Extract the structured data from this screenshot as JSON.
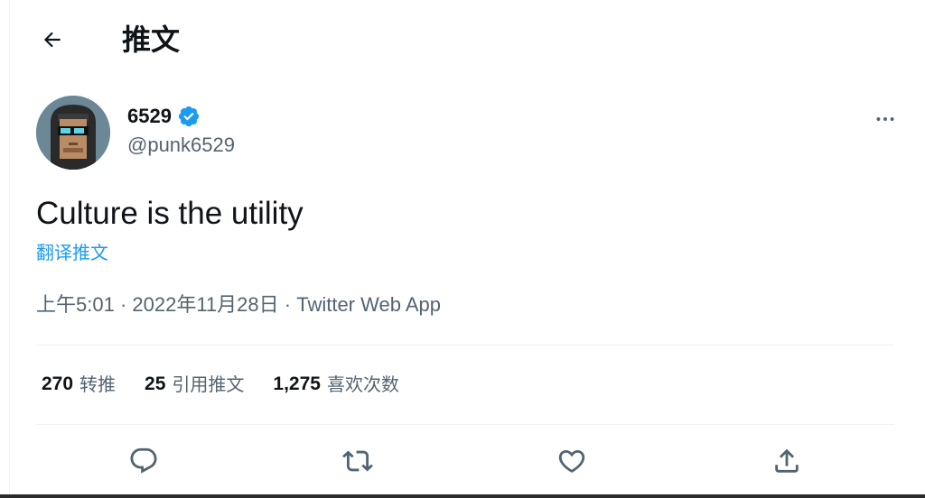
{
  "header": {
    "title": "推文"
  },
  "author": {
    "display_name": "6529",
    "handle": "@punk6529"
  },
  "tweet": {
    "text": "Culture is the utility",
    "translate_label": "翻译推文"
  },
  "meta": {
    "time": "上午5:01",
    "date": "2022年11月28日",
    "source": "Twitter Web App",
    "separator": " · "
  },
  "stats": {
    "retweets": {
      "count": "270",
      "label": "转推"
    },
    "quotes": {
      "count": "25",
      "label": "引用推文"
    },
    "likes": {
      "count": "1,275",
      "label": "喜欢次数"
    }
  },
  "icons": {
    "back": "arrow-left-icon",
    "verified": "verified-badge-icon",
    "more": "more-horizontal-icon",
    "reply": "reply-icon",
    "retweet": "retweet-icon",
    "like": "heart-icon",
    "share": "share-icon"
  },
  "colors": {
    "text": "#0f1419",
    "secondary": "#536471",
    "accent": "#1d9bf0",
    "divider": "#eff3f4"
  }
}
